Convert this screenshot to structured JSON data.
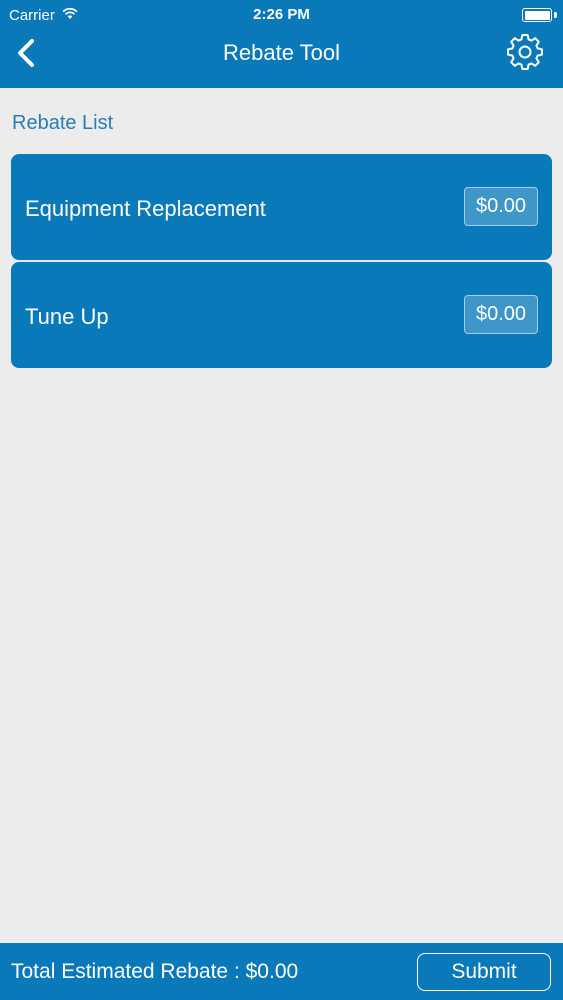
{
  "status_bar": {
    "carrier": "Carrier",
    "time": "2:26 PM",
    "wifi_icon": "wifi-icon",
    "battery_icon": "battery-icon"
  },
  "nav_bar": {
    "title": "Rebate Tool",
    "back_icon": "chevron-left-icon",
    "settings_icon": "gear-icon"
  },
  "rebate_list": {
    "heading": "Rebate List",
    "items": [
      {
        "label": "Equipment Replacement",
        "amount": "$0.00"
      },
      {
        "label": "Tune Up",
        "amount": "$0.00"
      }
    ]
  },
  "footer": {
    "total_text": "Total Estimated Rebate : $0.00",
    "submit_label": "Submit"
  },
  "colors": {
    "primary": "#0a79b9",
    "background": "#ececec",
    "heading": "#2a7cb6"
  }
}
